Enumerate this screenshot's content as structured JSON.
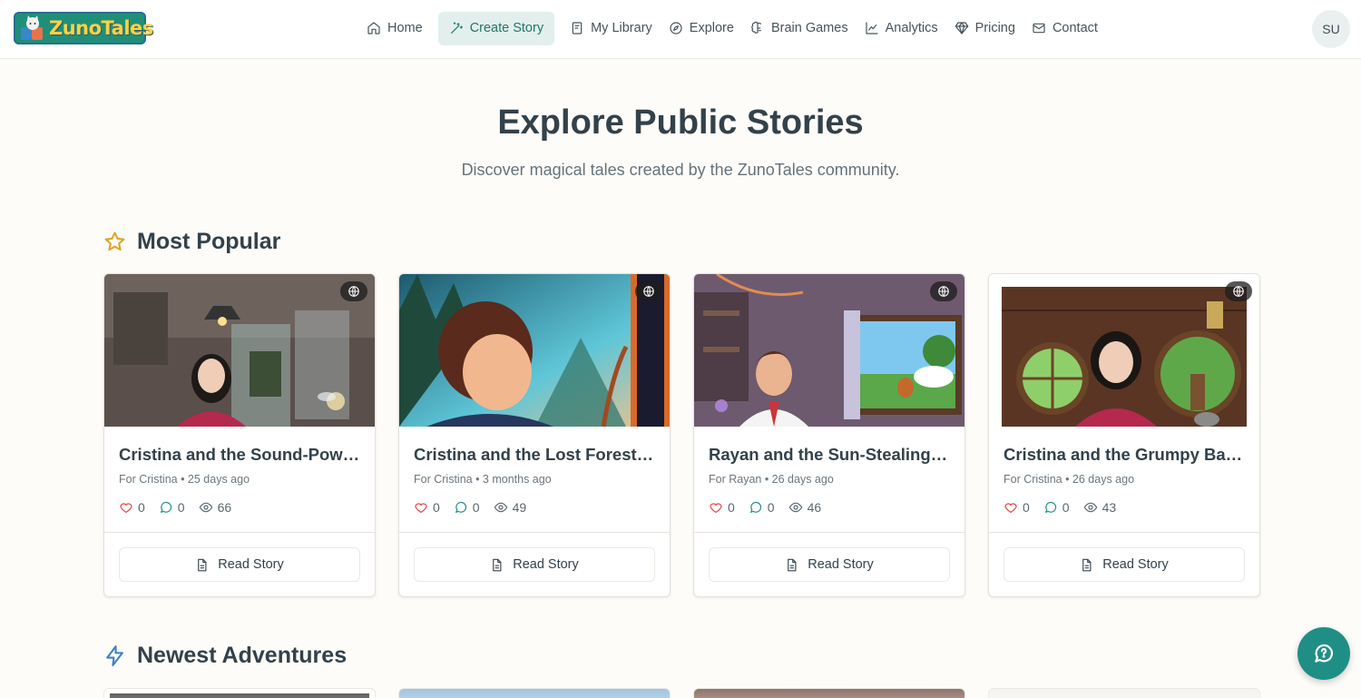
{
  "app": {
    "logo_text": "ZunoTales"
  },
  "nav": {
    "items": [
      {
        "label": "Home",
        "icon": "home-icon"
      },
      {
        "label": "Create Story",
        "icon": "wand-icon",
        "active": true
      },
      {
        "label": "My Library",
        "icon": "book-icon"
      },
      {
        "label": "Explore",
        "icon": "compass-icon"
      },
      {
        "label": "Brain Games",
        "icon": "brain-icon"
      },
      {
        "label": "Analytics",
        "icon": "chart-icon"
      },
      {
        "label": "Pricing",
        "icon": "gem-icon"
      },
      {
        "label": "Contact",
        "icon": "mail-icon"
      }
    ]
  },
  "user": {
    "initials": "SU"
  },
  "hero": {
    "title": "Explore Public Stories",
    "subtitle": "Discover magical tales created by the ZunoTales community."
  },
  "sections": {
    "popular": {
      "title": "Most Popular",
      "icon": "star-icon",
      "color": "#e0a526"
    },
    "newest": {
      "title": "Newest Adventures",
      "icon": "lightning-icon",
      "color": "#3b82c4"
    }
  },
  "cards": [
    {
      "title": "Cristina and the Sound-Powered Fairy",
      "meta": "For Cristina • 25 days ago",
      "likes": "0",
      "comments": "0",
      "views": "66",
      "button": "Read Story"
    },
    {
      "title": "Cristina and the Lost Forest Portal",
      "meta": "For Cristina • 3 months ago",
      "likes": "0",
      "comments": "0",
      "views": "49",
      "button": "Read Story"
    },
    {
      "title": "Rayan and the Sun-Stealing Squirrel",
      "meta": "For Rayan • 26 days ago",
      "likes": "0",
      "comments": "0",
      "views": "46",
      "button": "Read Story"
    },
    {
      "title": "Cristina and the Grumpy Badger",
      "meta": "For Cristina • 26 days ago",
      "likes": "0",
      "comments": "0",
      "views": "43",
      "button": "Read Story"
    }
  ],
  "colors": {
    "accent": "#1f8f86",
    "heart": "#e0474c",
    "comment": "#1f8f86"
  }
}
